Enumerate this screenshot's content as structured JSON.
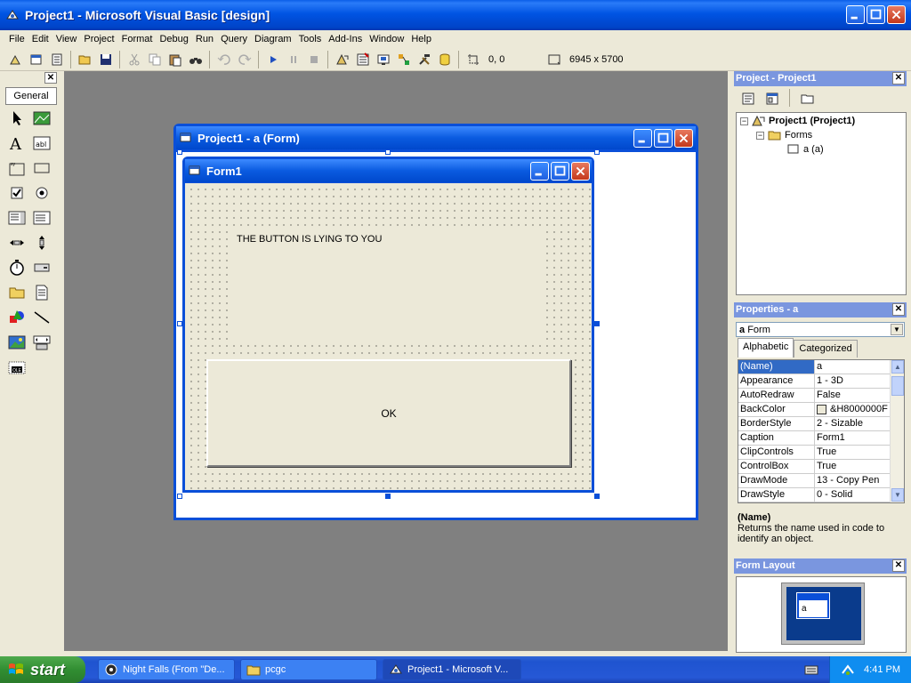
{
  "window": {
    "title": "Project1 - Microsoft Visual Basic [design]"
  },
  "menu": [
    "File",
    "Edit",
    "View",
    "Project",
    "Format",
    "Debug",
    "Run",
    "Query",
    "Diagram",
    "Tools",
    "Add-Ins",
    "Window",
    "Help"
  ],
  "toolbar": {
    "position_readout": "0, 0",
    "size_readout": "6945 x 5700"
  },
  "toolbox": {
    "tab_label": "General"
  },
  "designer": {
    "title": "Project1 - a (Form)",
    "form_title": "Form1",
    "label_caption": "THE BUTTON IS LYING TO YOU",
    "button_caption": "OK"
  },
  "project_panel": {
    "title": "Project - Project1",
    "tree": {
      "root": "Project1 (Project1)",
      "folder": "Forms",
      "item": "a (a)"
    }
  },
  "properties_panel": {
    "title": "Properties - a",
    "object_name": "a",
    "object_type": "Form",
    "tabs": [
      "Alphabetic",
      "Categorized"
    ],
    "rows": [
      {
        "name": "(Name)",
        "value": "a"
      },
      {
        "name": "Appearance",
        "value": "1 - 3D"
      },
      {
        "name": "AutoRedraw",
        "value": "False"
      },
      {
        "name": "BackColor",
        "value": "&H8000000F"
      },
      {
        "name": "BorderStyle",
        "value": "2 - Sizable"
      },
      {
        "name": "Caption",
        "value": "Form1"
      },
      {
        "name": "ClipControls",
        "value": "True"
      },
      {
        "name": "ControlBox",
        "value": "True"
      },
      {
        "name": "DrawMode",
        "value": "13 - Copy Pen"
      },
      {
        "name": "DrawStyle",
        "value": "0 - Solid"
      }
    ],
    "description_name": "(Name)",
    "description_text": "Returns the name used in code to identify an object."
  },
  "form_layout_panel": {
    "title": "Form Layout",
    "mini_form_label": "a"
  },
  "taskbar": {
    "start_label": "start",
    "tasks": [
      "Night Falls (From \"De...",
      "pcgc",
      "Project1 - Microsoft V..."
    ],
    "clock": "4:41 PM"
  },
  "colors": {
    "xp_blue": "#0a4fd8",
    "panel_title": "#7a96df",
    "mdi_background": "#808080"
  }
}
